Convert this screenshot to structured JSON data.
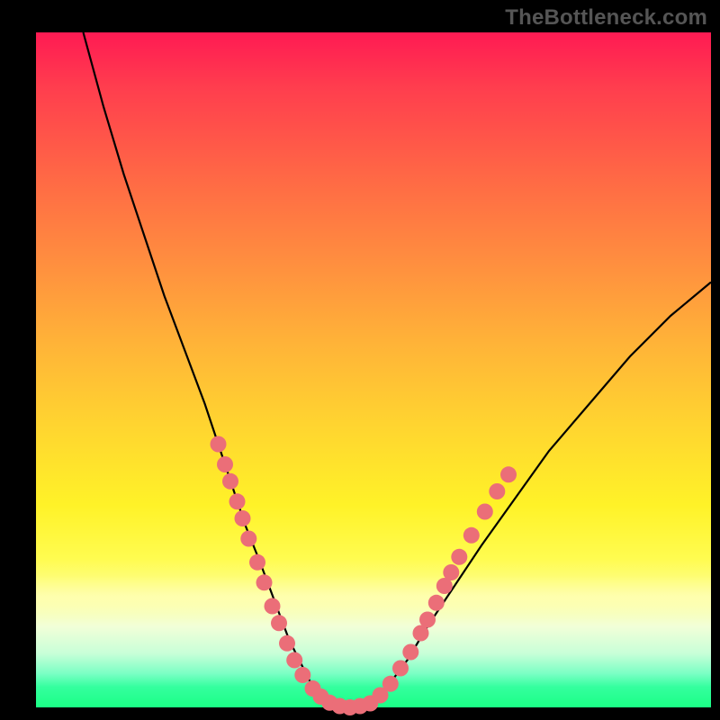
{
  "watermark": "TheBottleneck.com",
  "chart_data": {
    "type": "line",
    "title": "",
    "xlabel": "",
    "ylabel": "",
    "xlim": [
      0,
      100
    ],
    "ylim": [
      0,
      100
    ],
    "series": [
      {
        "name": "bottleneck-curve",
        "x": [
          7,
          10,
          13,
          16,
          19,
          22,
          25,
          27,
          29,
          31,
          33,
          34.5,
          36,
          37.5,
          39,
          40.5,
          42,
          44,
          46,
          49,
          52,
          55,
          58,
          62,
          66,
          71,
          76,
          82,
          88,
          94,
          100
        ],
        "y": [
          100,
          89,
          79,
          70,
          61,
          53,
          45,
          39,
          33,
          27,
          22,
          18,
          14,
          10,
          7,
          4,
          2,
          0.5,
          0,
          0.5,
          3,
          7,
          12,
          18,
          24,
          31,
          38,
          45,
          52,
          58,
          63
        ]
      }
    ],
    "scatter_markers": {
      "name": "sample-points",
      "points": [
        {
          "x": 27.0,
          "y": 39.0
        },
        {
          "x": 28.0,
          "y": 36.0
        },
        {
          "x": 28.8,
          "y": 33.5
        },
        {
          "x": 29.8,
          "y": 30.5
        },
        {
          "x": 30.6,
          "y": 28.0
        },
        {
          "x": 31.5,
          "y": 25.0
        },
        {
          "x": 32.8,
          "y": 21.5
        },
        {
          "x": 33.8,
          "y": 18.5
        },
        {
          "x": 35.0,
          "y": 15.0
        },
        {
          "x": 36.0,
          "y": 12.5
        },
        {
          "x": 37.2,
          "y": 9.5
        },
        {
          "x": 38.3,
          "y": 7.0
        },
        {
          "x": 39.5,
          "y": 4.8
        },
        {
          "x": 41.0,
          "y": 2.8
        },
        {
          "x": 42.2,
          "y": 1.6
        },
        {
          "x": 43.5,
          "y": 0.7
        },
        {
          "x": 45.0,
          "y": 0.2
        },
        {
          "x": 46.5,
          "y": 0.0
        },
        {
          "x": 48.0,
          "y": 0.2
        },
        {
          "x": 49.5,
          "y": 0.6
        },
        {
          "x": 51.0,
          "y": 1.8
        },
        {
          "x": 52.5,
          "y": 3.5
        },
        {
          "x": 54.0,
          "y": 5.8
        },
        {
          "x": 55.5,
          "y": 8.2
        },
        {
          "x": 57.0,
          "y": 11.0
        },
        {
          "x": 58.0,
          "y": 13.0
        },
        {
          "x": 59.3,
          "y": 15.5
        },
        {
          "x": 60.5,
          "y": 18.0
        },
        {
          "x": 61.5,
          "y": 20.0
        },
        {
          "x": 62.7,
          "y": 22.3
        },
        {
          "x": 64.5,
          "y": 25.5
        },
        {
          "x": 66.5,
          "y": 29.0
        },
        {
          "x": 68.3,
          "y": 32.0
        },
        {
          "x": 70.0,
          "y": 34.5
        }
      ]
    },
    "background_gradient": {
      "top": "#ff1a53",
      "mid": "#ffd82e",
      "bottom": "#1aff85"
    }
  }
}
